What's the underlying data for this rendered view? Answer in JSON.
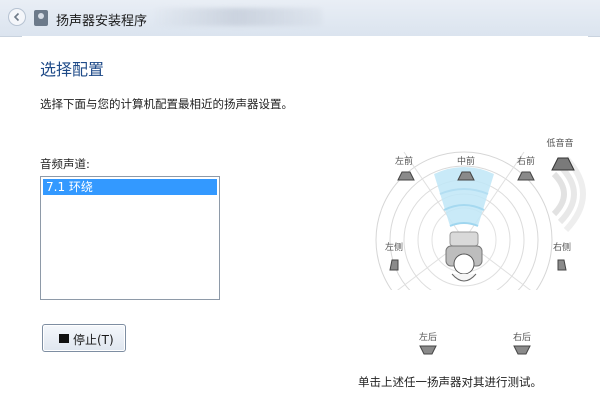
{
  "window": {
    "title": "扬声器安装程序"
  },
  "page": {
    "heading": "选择配置",
    "description": "选择下面与您的计算机配置最相近的扬声器设置。",
    "channel_label": "音频声道:",
    "channels": [
      {
        "label": "7.1 环绕",
        "selected": true
      }
    ],
    "stop_button_label": "停止(T)",
    "instruction": "单击上述任一扬声器对其进行测试。"
  },
  "speakers": {
    "front_left": "左前",
    "front_center": "中前",
    "front_right": "右前",
    "subwoofer": "低音音",
    "side_left": "左侧",
    "side_right": "右侧",
    "rear_left": "左后",
    "rear_right": "右后"
  },
  "colors": {
    "selection": "#3399ff",
    "heading": "#1e4a88",
    "sound_wave": "#bfe6f7"
  },
  "icons": [
    "back-arrow-icon",
    "speaker-app-icon",
    "stop-icon",
    "speaker-icon",
    "listener-icon"
  ]
}
